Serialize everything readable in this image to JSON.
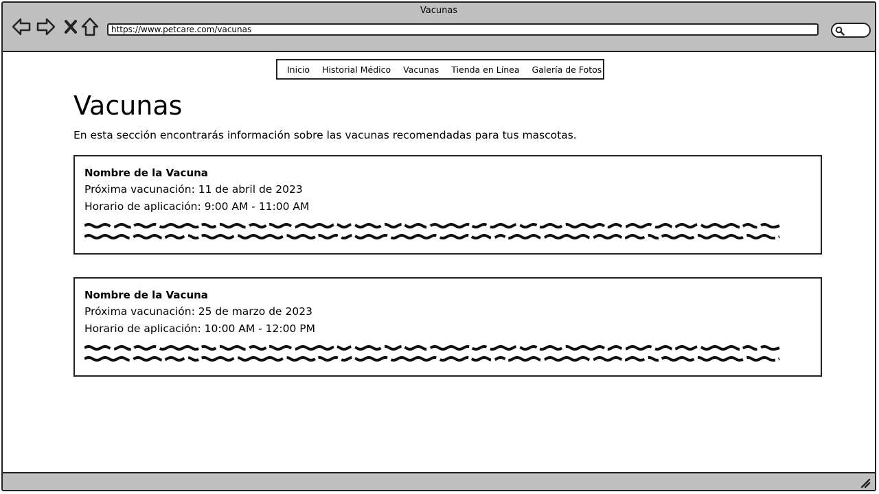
{
  "browser": {
    "window_title": "Vacunas",
    "url": "https://www.petcare.com/vacunas",
    "icons": [
      "back-arrow-icon",
      "forward-arrow-icon",
      "close-icon",
      "home-icon",
      "search-icon",
      "resize-grip-icon"
    ]
  },
  "nav": {
    "items": [
      {
        "label": "Inicio"
      },
      {
        "label": "Historial Médico"
      },
      {
        "label": "Vacunas"
      },
      {
        "label": "Tienda en Línea"
      },
      {
        "label": "Galería de Fotos"
      }
    ]
  },
  "main": {
    "title": "Vacunas",
    "intro": "En esta sección encontrarás información sobre las vacunas recomendadas para tus mascotas.",
    "vaccines": [
      {
        "name": "Nombre de la Vacuna",
        "next": "Próxima vacunación: 11 de abril de 2023",
        "hours": "Horario de aplicación: 9:00 AM - 11:00 AM"
      },
      {
        "name": "Nombre de la Vacuna",
        "next": "Próxima vacunación: 25 de marzo de 2023",
        "hours": "Horario de aplicación: 10:00 AM - 12:00 PM"
      }
    ]
  }
}
